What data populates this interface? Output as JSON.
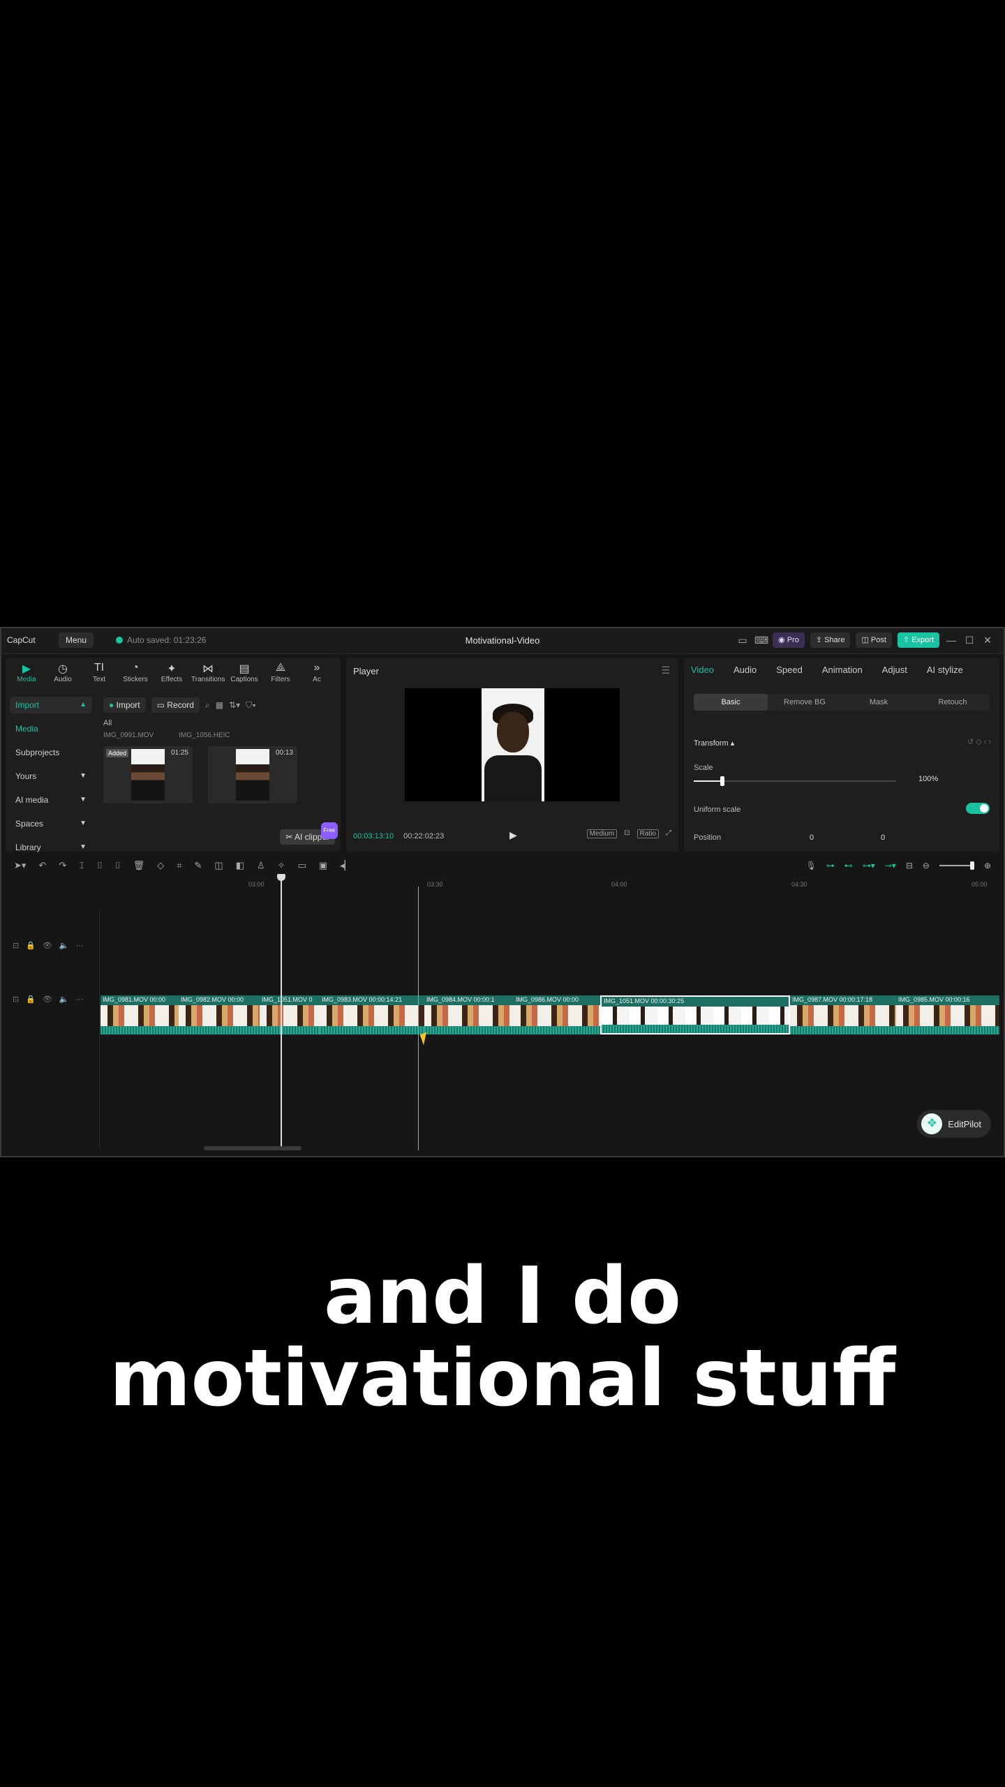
{
  "titlebar": {
    "logo": "CapCut",
    "menu": "Menu",
    "autosave": "Auto saved: 01:23:26",
    "title": "Motivational-Video",
    "pro": "Pro",
    "share": "Share",
    "post": "Post",
    "export": "Export"
  },
  "tools": [
    {
      "label": "Media",
      "icon": "▶"
    },
    {
      "label": "Audio",
      "icon": "◷"
    },
    {
      "label": "Text",
      "icon": "TI"
    },
    {
      "label": "Stickers",
      "icon": "◔"
    },
    {
      "label": "Effects",
      "icon": "✦"
    },
    {
      "label": "Transitions",
      "icon": "⋈"
    },
    {
      "label": "Captions",
      "icon": "▤"
    },
    {
      "label": "Filters",
      "icon": "⟁"
    },
    {
      "label": "Ac",
      "icon": "»"
    }
  ],
  "sidebar": {
    "import": "Import",
    "media": "Media",
    "subprojects": "Subprojects",
    "yours": "Yours",
    "ai_media": "AI media",
    "spaces": "Spaces",
    "library": "Library"
  },
  "media": {
    "import_btn": "Import",
    "record_btn": "Record",
    "all": "All",
    "files": [
      "IMG_0991.MOV",
      "IMG_1056.HEIC"
    ],
    "thumbs": [
      {
        "added": "Added",
        "duration": "01:25"
      },
      {
        "duration": "00:13"
      }
    ],
    "ai_clipper": "AI clipper",
    "free": "Free"
  },
  "player": {
    "title": "Player",
    "current": "00:03:13:10",
    "total": "00:22:02:23",
    "quality": "Medium",
    "ratio": "Ratio"
  },
  "props": {
    "tabs": [
      "Video",
      "Audio",
      "Speed",
      "Animation",
      "Adjust",
      "AI stylize"
    ],
    "subtabs": [
      "Basic",
      "Remove BG",
      "Mask",
      "Retouch"
    ],
    "transform": "Transform",
    "scale_label": "Scale",
    "scale_value": "100%",
    "scale_fraction": 0.14,
    "uniform_scale": "Uniform scale",
    "position": "Position",
    "pos_x": "0",
    "pos_y": "0"
  },
  "ruler": [
    "03:00",
    "03:30",
    "04:00",
    "04:30",
    "05:00"
  ],
  "clips": [
    {
      "label": "IMG_0981.MOV 00:00"
    },
    {
      "label": "IMG_0982.MOV 00:00"
    },
    {
      "label": "IMG_1051.MOV 0"
    },
    {
      "label": "IMG_0983.MOV 00:00:14:21"
    },
    {
      "label": "IMG_0984.MOV 00:00:1"
    },
    {
      "label": "IMG_0986.MOV 00:00"
    },
    {
      "label": "IMG_1051.MOV 00:00:30:25"
    },
    {
      "label": "IMG_0987.MOV 00:00:17:18"
    },
    {
      "label": "IMG_0985.MOV 00:00:16"
    }
  ],
  "editpilot": "EditPilot",
  "caption": {
    "line1": "and I do",
    "line2": "motivational stuff"
  }
}
